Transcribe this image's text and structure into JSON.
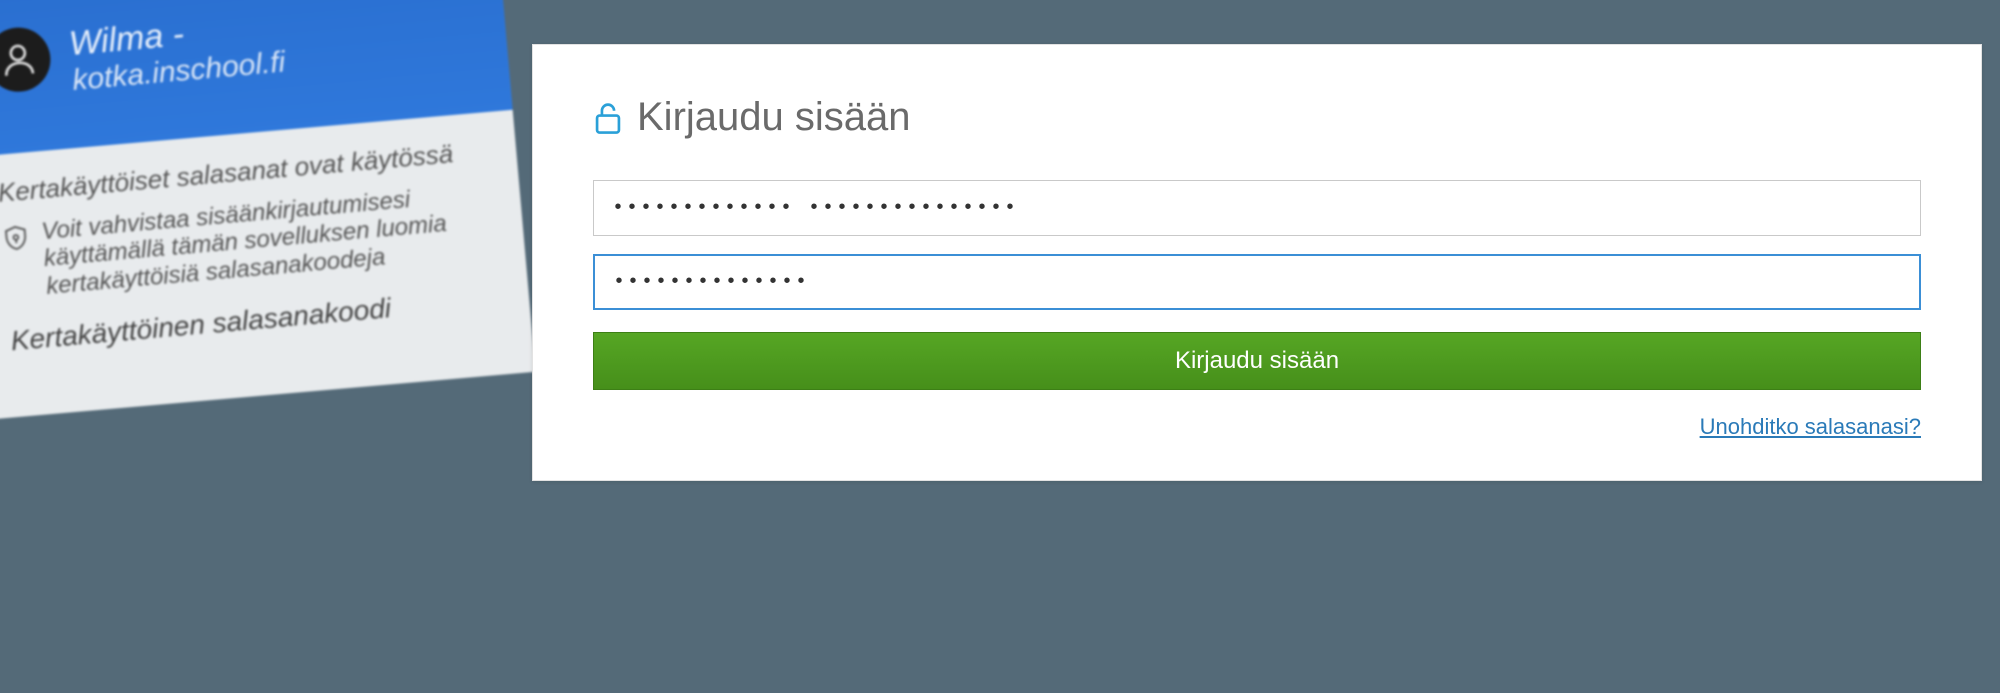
{
  "phone": {
    "app_name": "Wilma -",
    "domain": "kotka.inschool.fi",
    "otp_section_title": "Kertakäyttöiset salasanat ovat käytössä",
    "otp_description": "Voit vahvistaa sisäänkirjautumisesi käyttämällä tämän sovelluksen luomia kertakäyttöisiä salasanakoodeja",
    "otp_label": "Kertakäyttöinen salasanakoodi"
  },
  "login": {
    "heading": "Kirjaudu sisään",
    "username_value": "••••••••••••• •••••••••••••••",
    "password_value": "••••••••••••••",
    "submit_label": "Kirjaudu sisään",
    "forgot_label": "Unohditko salasanasi?"
  }
}
